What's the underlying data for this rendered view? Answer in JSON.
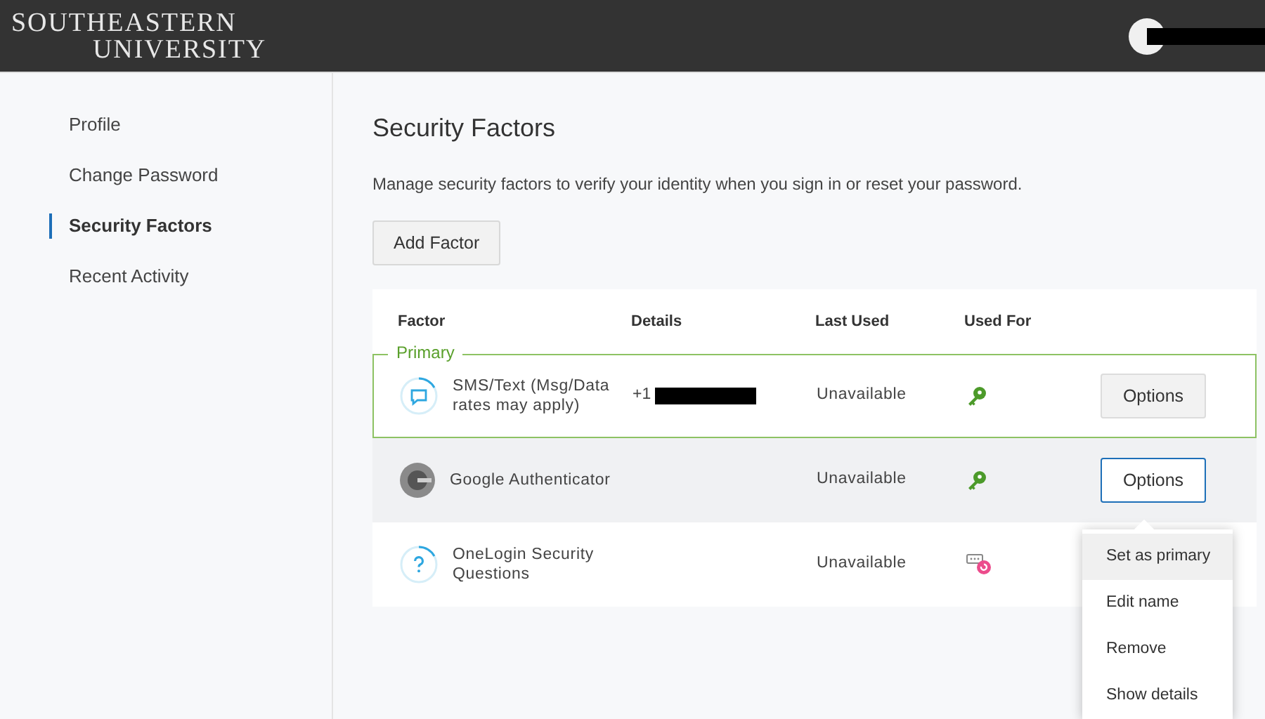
{
  "header": {
    "logo_line_1": "SOUTHEASTERN",
    "logo_line_2": "UNIVERSITY"
  },
  "sidebar": {
    "items": [
      {
        "label": "Profile",
        "selected": false
      },
      {
        "label": "Change Password",
        "selected": false
      },
      {
        "label": "Security Factors",
        "selected": true
      },
      {
        "label": "Recent Activity",
        "selected": false
      }
    ]
  },
  "page": {
    "title": "Security Factors",
    "description": "Manage security factors to verify your identity when you sign in or reset your password.",
    "add_button": "Add Factor"
  },
  "table": {
    "columns": [
      "Factor",
      "Details",
      "Last Used",
      "Used For"
    ],
    "rows": [
      {
        "kind": "sms",
        "factor": "SMS/Text (Msg/Data rates may apply)",
        "details": "+1",
        "last_used": "Unavailable",
        "used_for": {
          "kind": "key"
        },
        "primary": true,
        "primary_label": "Primary",
        "highlighted": false,
        "options": "Options",
        "focused": false
      },
      {
        "kind": "authenticator",
        "factor": "Google Authenticator",
        "last_used": "Unavailable",
        "used_for": {
          "kind": "key"
        },
        "primary": false,
        "highlighted": true,
        "options": "Options",
        "focused": true
      },
      {
        "kind": "question",
        "factor": "OneLogin Security Questions",
        "last_used": "Unavailable",
        "used_for": {
          "kind": "reset"
        },
        "primary": false,
        "highlighted": false
      }
    ]
  },
  "menu": {
    "items": [
      {
        "label": "Set as primary",
        "selected": true
      },
      {
        "label": "Edit name",
        "selected": false
      },
      {
        "label": "Remove",
        "selected": false
      },
      {
        "label": "Show details",
        "selected": false
      }
    ]
  }
}
